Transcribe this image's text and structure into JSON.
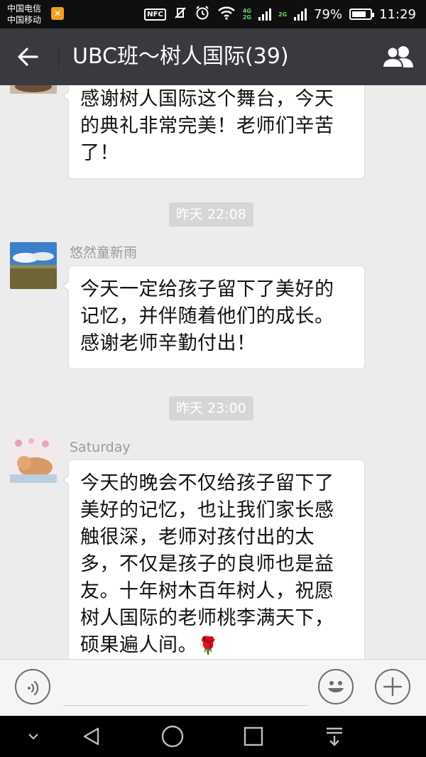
{
  "status_bar": {
    "carrier_1": "中国电信",
    "carrier_2": "中国移动",
    "nfc": "NFC",
    "net_4g": "4G",
    "net_2g_a": "2G",
    "net_2g_b": "2G",
    "battery_percent": "79%",
    "battery_level": 0.79,
    "time": "11:29"
  },
  "header": {
    "title": "UBC班～树人国际(39)",
    "back_icon": "back-arrow-icon",
    "members_icon": "group-members-icon"
  },
  "messages": [
    {
      "sender": "",
      "text": "感谢树人国际这个舞台，今天的典礼非常完美！老师们辛苦了！"
    },
    {
      "timestamp": "昨天 22:08",
      "sender": "悠然童新雨",
      "text": "今天一定给孩子留下了美好的记忆，并伴随着他们的成长。感谢老师辛勤付出！"
    },
    {
      "timestamp": "昨天 23:00",
      "sender": "Saturday",
      "text": "今天的晚会不仅给孩子留下了美好的记忆，也让我们家长感触很深，老师对孩付出的太多，不仅是孩子的良师也是益友。十年树木百年树人，祝愿树人国际的老师桃李满天下，硕果遍人间。",
      "emoji": "🌹"
    }
  ],
  "input_bar": {
    "voice_icon": "voice-input-icon",
    "emoji_icon": "emoji-face-icon",
    "plus_icon": "plus-icon",
    "placeholder": ""
  },
  "nav_bar": {
    "icons": [
      "collapse-icon",
      "back-triangle-icon",
      "home-circle-icon",
      "recents-square-icon",
      "notification-pull-icon"
    ]
  },
  "colors": {
    "title_bar": "#393a3f",
    "chat_bg": "#ececec",
    "bubble": "#ffffff",
    "status_bar": "#0f0f0f"
  }
}
